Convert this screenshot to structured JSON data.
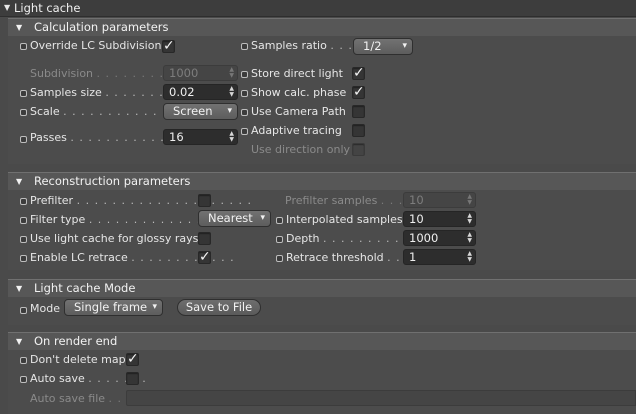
{
  "window": {
    "title": "Light cache"
  },
  "calc": {
    "header": "Calculation parameters",
    "override_label": "Override LC Subdivision",
    "samples_ratio_label": "Samples ratio",
    "samples_ratio_dots": ". . .",
    "samples_ratio_value": "1/2",
    "subdivision_label": "Subdivision",
    "subdivision_dots": ". . . . . . . . . . .",
    "subdivision_value": "1000",
    "store_direct_label": "Store direct light",
    "samples_size_label": "Samples size",
    "samples_size_dots": ". . . . . . . . .",
    "samples_size_value": "0.02",
    "show_calc_label": "Show calc. phase",
    "scale_label": "Scale",
    "scale_dots": ". . . . . . . . . . . . . . . .",
    "scale_value": "Screen",
    "camera_path_label": "Use Camera Path",
    "adaptive_label": "Adaptive tracing",
    "passes_label": "Passes",
    "passes_dots": ". . . . . . . . . . . . . .",
    "passes_value": "16",
    "direction_only_label": "Use direction only"
  },
  "recon": {
    "header": "Reconstruction parameters",
    "prefilter_label": "Prefilter",
    "prefilter_dots": ". . . . . . . . . . . . . . . . . . . .",
    "prefilter_samples_label": "Prefilter samples",
    "prefilter_samples_dots": ". . . .",
    "prefilter_samples_value": "10",
    "filter_type_label": "Filter type",
    "filter_type_dots": ". . . . . . . . . . . . . . . . .",
    "filter_type_value": "Nearest",
    "interp_label": "Interpolated samples",
    "interp_value": "10",
    "glossy_label": "Use light cache for glossy rays",
    "depth_label": "Depth",
    "depth_dots": ". . . . . . . . . . . . .",
    "depth_value": "1000",
    "retrace_label": "Enable LC retrace",
    "retrace_dots": ". . . . . . . . . . . .",
    "retrace_threshold_label": "Retrace threshold",
    "retrace_threshold_dots": ". . . .",
    "retrace_threshold_value": "1"
  },
  "mode": {
    "header": "Light cache Mode",
    "mode_label": "Mode",
    "mode_value": "Single frame",
    "save_button": "Save to File"
  },
  "render_end": {
    "header": "On render end",
    "dont_delete_label": "Don't delete map",
    "auto_save_label": "Auto save",
    "auto_save_dots": ". . . . . . .",
    "auto_save_file_label": "Auto save file",
    "auto_save_file_dots": ". . ."
  }
}
